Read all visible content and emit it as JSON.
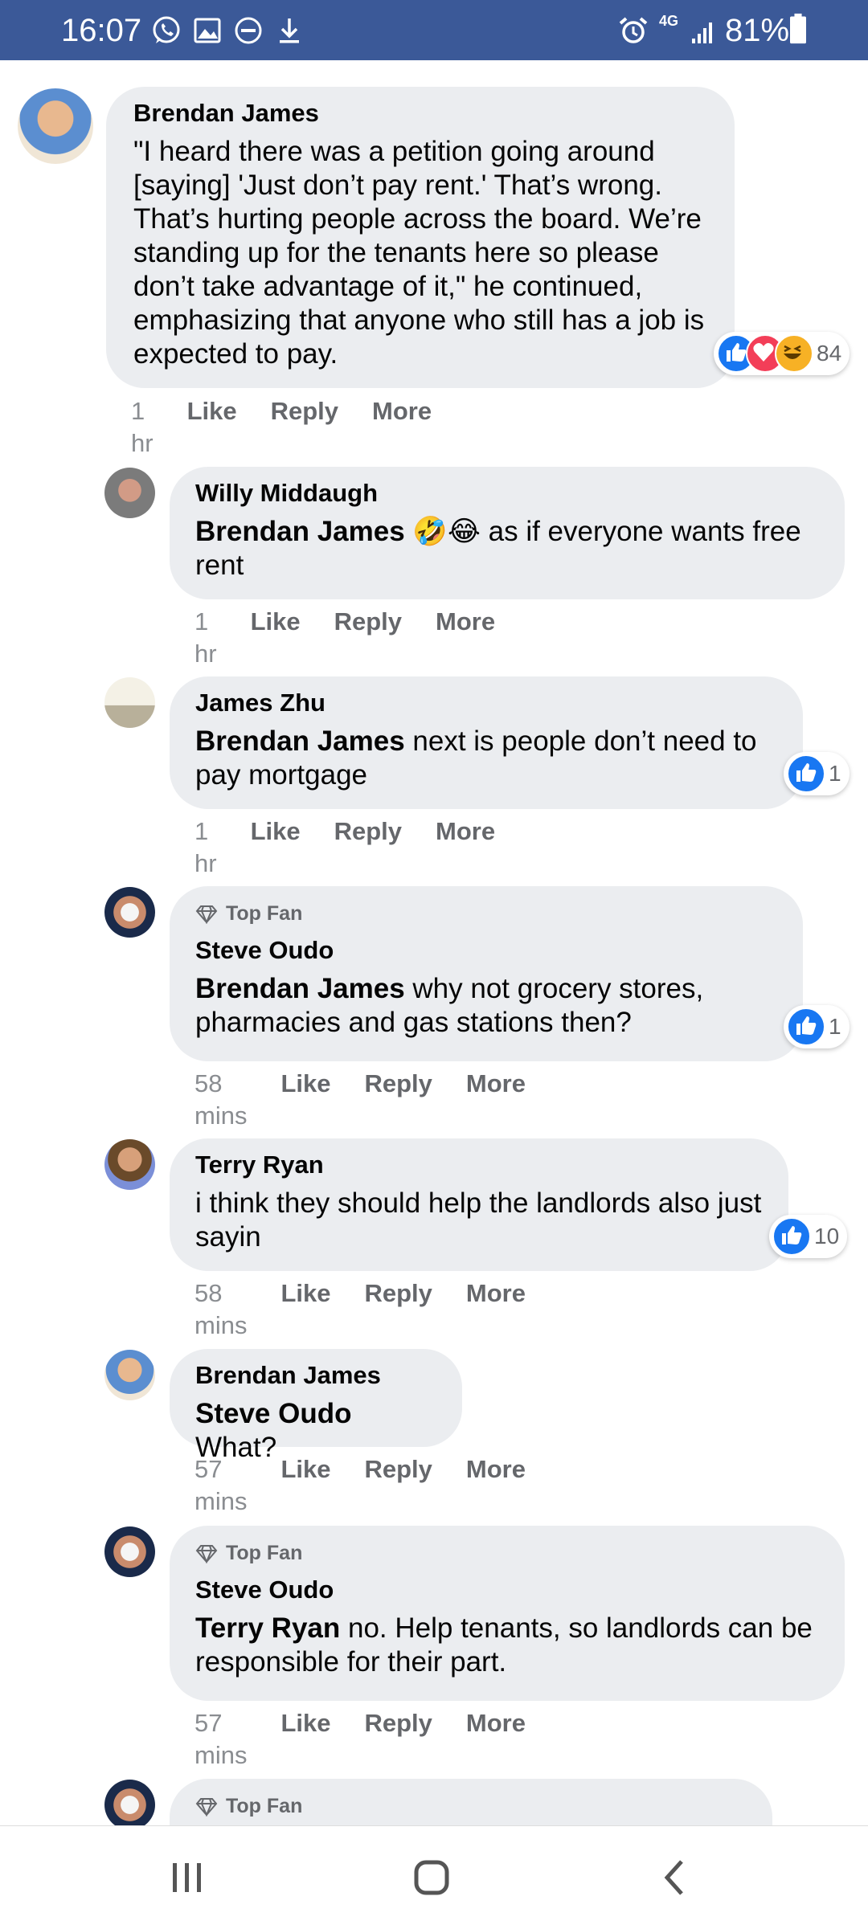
{
  "status_bar": {
    "time": "16:07",
    "network": "4G",
    "battery": "81%",
    "icons": [
      "whatsapp-icon",
      "gallery-icon",
      "dnd-icon",
      "download-icon",
      "alarm-icon",
      "signal-icon",
      "battery-icon"
    ],
    "color": "#3b5998"
  },
  "labels": {
    "like": "Like",
    "reply": "Reply",
    "more": "More",
    "top_fan": "Top Fan"
  },
  "comments": [
    {
      "author": "Brendan James",
      "mention": "",
      "text": "\"I heard there was a petition going around [saying] 'Just don’t pay rent.' That’s wrong. That’s hurting people across the board. We’re standing up for the tenants here so please don’t take advantage of it,\" he continued, emphasizing that anyone who still has a job is expected to pay.",
      "time": "1 hr",
      "reactions": "84"
    },
    {
      "author": "Willy Middaugh",
      "mention": "Brendan James",
      "emoji": "🤣😂",
      "text": "as if everyone wants free rent",
      "time": "1 hr"
    },
    {
      "author": "James Zhu",
      "mention": "Brendan James",
      "text": "next is people don’t need to pay mortgage",
      "time": "1 hr",
      "reactions": "1"
    },
    {
      "author": "Steve Oudo",
      "top_fan": true,
      "mention": "Brendan James",
      "text": "why not grocery stores, pharmacies and gas stations then?",
      "time": "58 mins",
      "reactions": "1"
    },
    {
      "author": "Terry Ryan",
      "mention": "",
      "text": "i think they should help the landlords also just sayin",
      "time": "58 mins",
      "reactions": "10"
    },
    {
      "author": "Brendan James",
      "mention": "Steve Oudo",
      "text": "What?",
      "time": "57 mins"
    },
    {
      "author": "Steve Oudo",
      "top_fan": true,
      "mention": "Terry Ryan",
      "text": "no. Help tenants, so landlords can be responsible for their part.",
      "time": "57 mins"
    },
    {
      "top_fan": true
    }
  ],
  "nav_bar": {
    "buttons": [
      "recent-apps-button",
      "home-button",
      "back-button"
    ]
  }
}
